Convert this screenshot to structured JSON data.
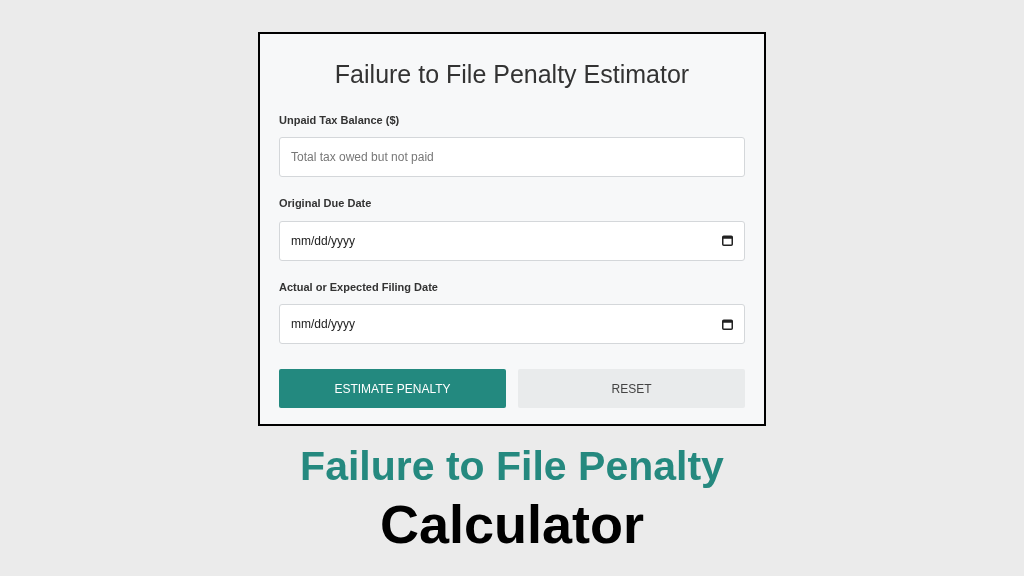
{
  "form": {
    "title": "Failure to File Penalty Estimator",
    "fields": [
      {
        "kind": "text",
        "label": "Unpaid Tax Balance ($)",
        "placeholder": "Total tax owed but not paid"
      },
      {
        "kind": "date",
        "label": "Original Due Date",
        "placeholder": "mm/dd/yyyy"
      },
      {
        "kind": "date",
        "label": "Actual or Expected Filing Date",
        "placeholder": "mm/dd/yyyy"
      }
    ],
    "buttons": [
      {
        "label": "ESTIMATE PENALTY",
        "kind": "primary"
      },
      {
        "label": "RESET",
        "kind": "secondary"
      }
    ]
  },
  "heading": {
    "line_1": "Failure to File Penalty",
    "line_2": "Calculator"
  }
}
